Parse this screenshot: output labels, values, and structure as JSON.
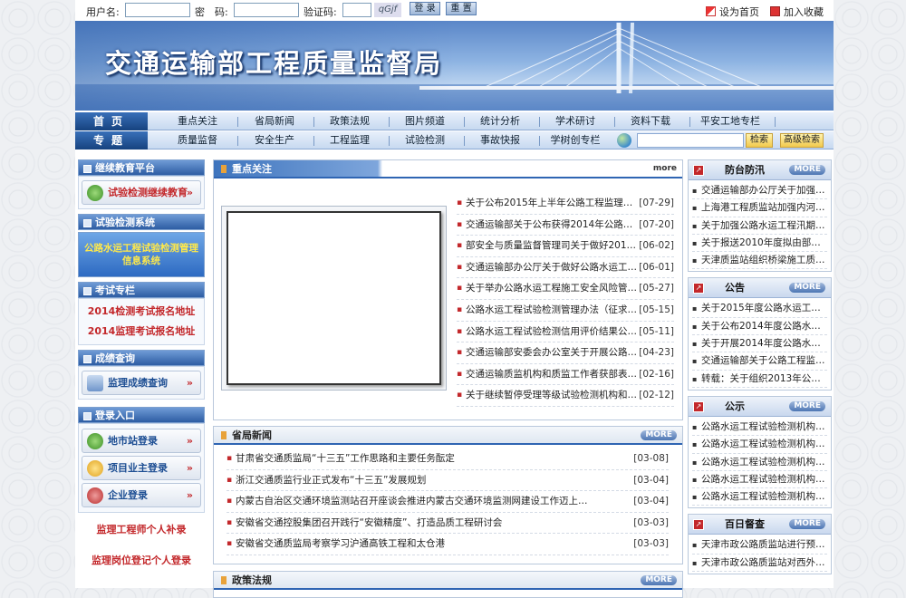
{
  "topbar": {
    "username_label": "用户名:",
    "password_label": "密　码:",
    "captcha_label": "验证码:",
    "captcha_image": "qGjf",
    "login_button": "登 录",
    "reset_button": "重 置",
    "set_home": "设为首页",
    "add_favorite": "加入收藏"
  },
  "banner": {
    "title": "交通运输部工程质量监督局"
  },
  "nav1": {
    "head": "首页",
    "items": [
      "重点关注",
      "省局新闻",
      "政策法规",
      "图片频道",
      "统计分析",
      "学术研讨",
      "资料下载",
      "平安工地专栏"
    ]
  },
  "nav2": {
    "head": "专题",
    "items": [
      "质量监督",
      "安全生产",
      "工程监理",
      "试验检测",
      "事故快报",
      "学树创专栏"
    ],
    "search_button": "检索",
    "advanced_search_button": "高级检索"
  },
  "left": {
    "continuing_ed_head": "继续教育平台",
    "continuing_ed_button": "试验检测继续教育",
    "testing_system_head": "试验检测系统",
    "testing_system_banner": "公路水运工程试验检测管理信息系统",
    "exam_head": "考试专栏",
    "exam_links": [
      "2014检测考试报名地址",
      "2014监理考试报名地址"
    ],
    "score_head": "成绩查询",
    "score_button": "监理成绩查询",
    "login_head": "登录入口",
    "login_buttons": [
      "地市站登录",
      "项目业主登录",
      "企业登录"
    ],
    "extra_links": [
      "监理工程师个人补录",
      "监理岗位登记个人登录"
    ]
  },
  "focus": {
    "title": "重点关注",
    "more": "more",
    "items": [
      {
        "text": "关于公布2015年上半年公路工程监理企…",
        "date": "[07-29]"
      },
      {
        "text": "交通运输部关于公布获得2014年公路水…",
        "date": "[07-20]"
      },
      {
        "text": "部安全与质量监督管理司关于做好201…",
        "date": "[06-02]"
      },
      {
        "text": "交通运输部办公厅关于做好公路水运工…",
        "date": "[06-01]"
      },
      {
        "text": "关于举办公路水运工程施工安全风险管…",
        "date": "[05-27]"
      },
      {
        "text": "公路水运工程试验检测管理办法（征求…",
        "date": "[05-15]"
      },
      {
        "text": "公路水运工程试验检测信用评价结果公…",
        "date": "[05-11]"
      },
      {
        "text": "交通运输部安委会办公室关于开展公路…",
        "date": "[04-23]"
      },
      {
        "text": "交通运输质监机构和质监工作者获部表…",
        "date": "[02-16]"
      },
      {
        "text": "关于继续暂停受理等级试验检测机构和…",
        "date": "[02-12]"
      }
    ]
  },
  "provincial": {
    "title": "省局新闻",
    "more": "MORE",
    "items": [
      {
        "text": "甘肃省交通质监局“十三五”工作思路和主要任务酝定",
        "date": "[03-08]"
      },
      {
        "text": "浙江交通质监行业正式发布“十三五”发展规划",
        "date": "[03-04]"
      },
      {
        "text": "内蒙古自治区交通环境监测站召开座谈会推进内蒙古交通环境监测网建设工作迈上…",
        "date": "[03-04]"
      },
      {
        "text": "安徽省交通控股集团召开践行“安徽精度”、打造品质工程研讨会",
        "date": "[03-03]"
      },
      {
        "text": "安徽省交通质监局考察学习沪通高铁工程和太仓港",
        "date": "[03-03]"
      }
    ]
  },
  "policy": {
    "title": "政策法规",
    "more": "MORE"
  },
  "right": [
    {
      "title": "防台防汛",
      "more": "MORE",
      "items": [
        "交通运输部办公厅关于加强…",
        "上海港工程质监站加强内河…",
        "关于加强公路水运工程汛期…",
        "关于报送2010年度拟由部组…",
        "天津质监站组织桥梁施工质…"
      ]
    },
    {
      "title": "公告",
      "more": "MORE",
      "items": [
        "关于2015年度公路水运工…",
        "关于公布2014年度公路水运…",
        "关于开展2014年度公路水运…",
        "交通运输部关于公路工程监…",
        "转载：关于组织2013年公路…"
      ]
    },
    {
      "title": "公示",
      "more": "MORE",
      "items": [
        "公路水运工程试验检测机构…",
        "公路水运工程试验检测机构…",
        "公路水运工程试验检测机构…",
        "公路水运工程试验检测机构…",
        "公路水运工程试验检测机构…"
      ]
    },
    {
      "title": "百日督查",
      "more": "MORE",
      "items": [
        "天津市政公路质监站进行预…",
        "天津市政公路质监站对西外…"
      ]
    }
  ],
  "colors": {
    "accent": "#2f65b3",
    "brand_red": "#c3282b",
    "nav_dark": "#16427f"
  }
}
